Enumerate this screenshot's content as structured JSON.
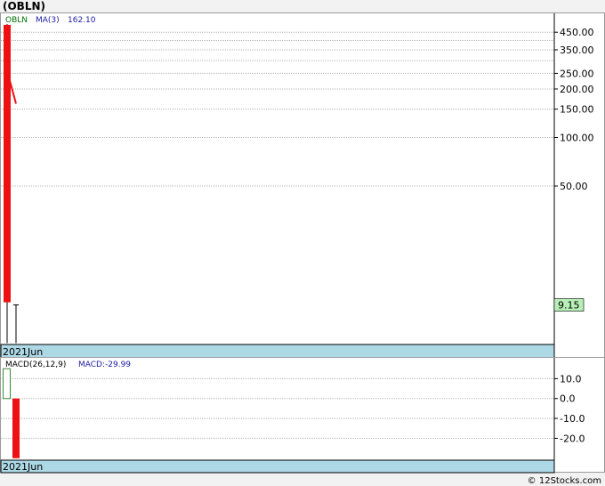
{
  "title": "(OBLN)",
  "footer": "© 12Stocks.com",
  "colors": {
    "grid": "#b8b8b8",
    "date_band": "#add8e6",
    "bear_candle": "#ee1111",
    "bull_candle": "#3a8a3a",
    "ma_line": "#ee1111",
    "symbol_text": "#007000",
    "ma_text": "#1a1aa0",
    "last_price_box": "#b7f0b7"
  },
  "chart_data": [
    {
      "type": "candlestick",
      "panel": "price",
      "scale": "log",
      "legend": {
        "symbol": "OBLN",
        "ma_label": "MA(3)",
        "ma_value": "162.10"
      },
      "yticks": [
        450,
        350,
        250,
        200,
        150,
        100,
        50
      ],
      "ytick_labels": [
        "450.00",
        "350.00",
        "250.00",
        "200.00",
        "150.00",
        "100.00",
        "50.00"
      ],
      "extra_gridlines": [
        400,
        300
      ],
      "ylim": [
        5.2,
        560
      ],
      "x_label": "2021Jun",
      "last_price_label": "9.15",
      "candles": [
        {
          "open": 500,
          "close": 9.5,
          "high": 505,
          "low": 5.3
        },
        {
          "open": 9.15,
          "close": 9.15,
          "high": 9.15,
          "low": 5.3
        }
      ],
      "ma_line": [
        {
          "candle": 0,
          "value": 260
        },
        {
          "candle": 1,
          "value": 162.1
        }
      ]
    },
    {
      "type": "bar",
      "panel": "macd",
      "legend": {
        "label": "MACD(26,12,9)",
        "value_label": "MACD:-29.99"
      },
      "yticks": [
        10,
        0,
        -10,
        -20
      ],
      "ytick_labels": [
        "10.0",
        "0.0",
        "-10.0",
        "-20.0"
      ],
      "ylim": [
        -31,
        16
      ],
      "x_label": "2021Jun",
      "bars": [
        {
          "value": 15,
          "style": "outline"
        },
        {
          "value": -29.99,
          "style": "filled"
        }
      ]
    }
  ]
}
